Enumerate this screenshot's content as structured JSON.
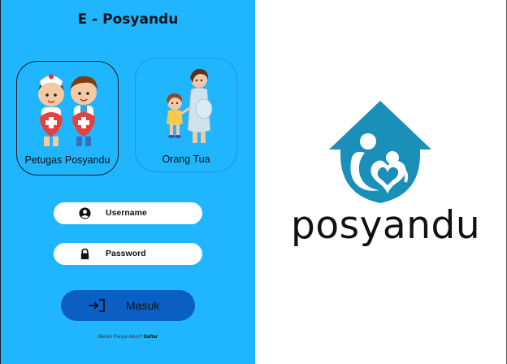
{
  "app": {
    "title": "E - Posyandu"
  },
  "roles": [
    {
      "label": "Petugas Posyandu",
      "icon": "health-workers-illustration",
      "selected": true
    },
    {
      "label": "Orang Tua",
      "icon": "mother-child-illustration",
      "selected": false
    }
  ],
  "form": {
    "username_placeholder": "Username",
    "password_placeholder": "Password",
    "submit_label": "Masuk",
    "register_prompt": "Belum Punya Akun?",
    "register_link": "Daftar"
  },
  "branding": {
    "wordmark": "posyandu",
    "logo_icon": "home-family-heart-icon"
  },
  "colors": {
    "panel": "#1fb6ff",
    "button": "#0b5fc4",
    "logo": "#1a8fb8"
  }
}
